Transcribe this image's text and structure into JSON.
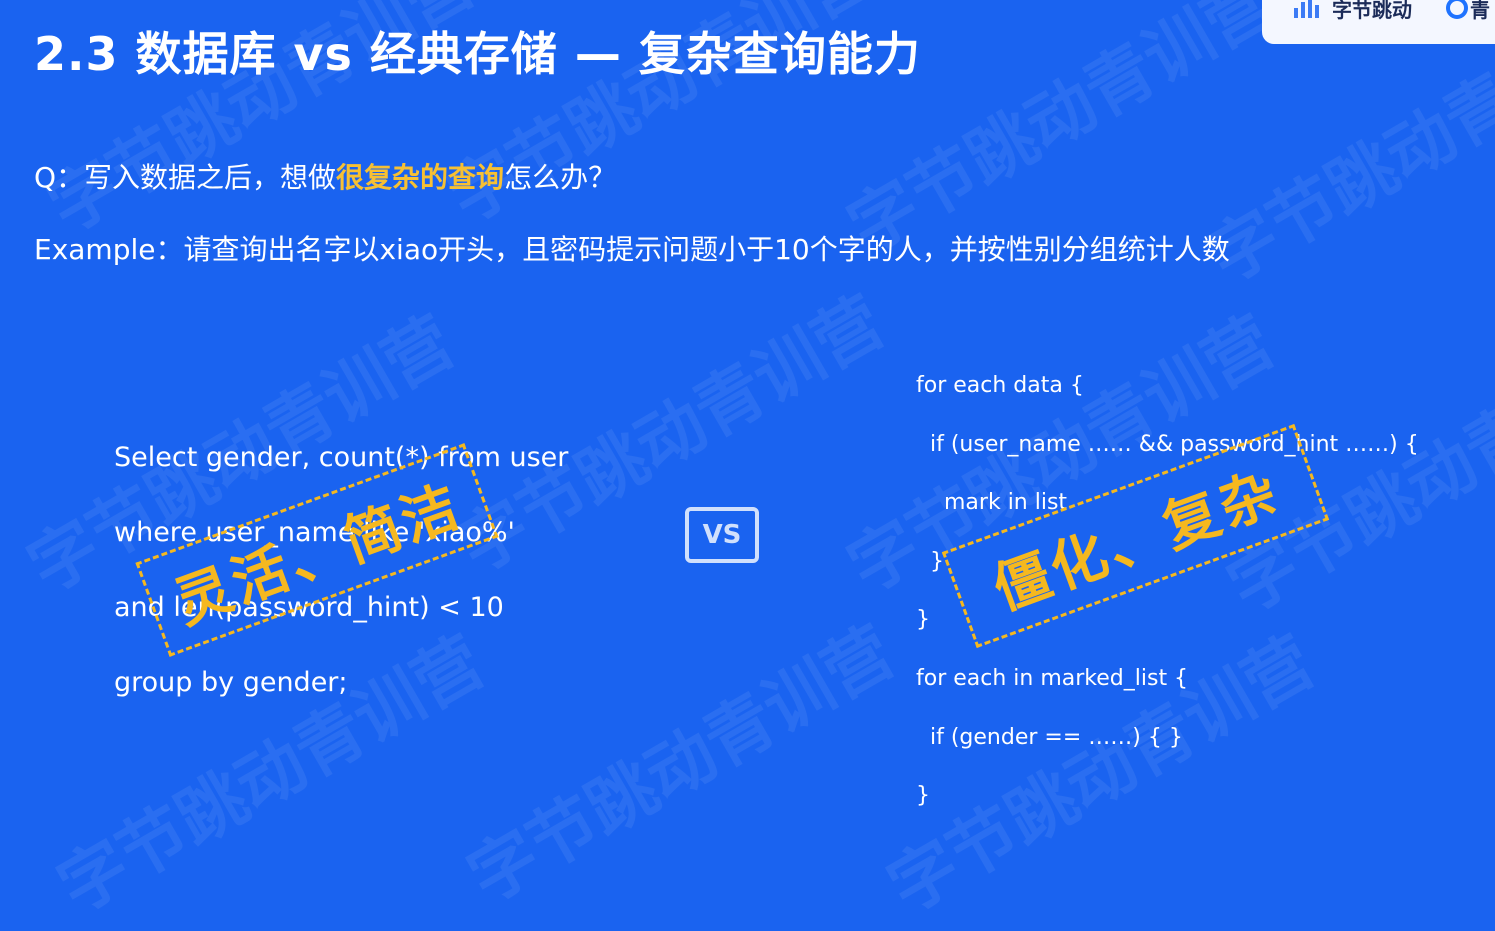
{
  "title": "2.3 数据库 vs 经典存储 — 复杂查询能力",
  "logo": {
    "brand": "字节跳动",
    "brand2": "青"
  },
  "question": {
    "prefix": "Q：写入数据之后，想做",
    "highlight": "很复杂的查询",
    "suffix": "怎么办？"
  },
  "example": "Example：请查询出名字以xiao开头，且密码提示问题小于10个字的人，并按性别分组统计人数",
  "sql_lines": [
    "Select gender, count(*) from user",
    "where user_name like 'xiao%'",
    "and len(password_hint) < 10",
    "group by gender;"
  ],
  "vs_label": "VS",
  "code_lines": [
    "for each data {",
    "  if (user_name …… && password_hint ……) {",
    "    mark in list",
    "  }",
    "}",
    "for each in marked_list {",
    "  if (gender == ……) { }",
    "}"
  ],
  "stamp_left": "灵活、简洁",
  "stamp_right": "僵化、复杂",
  "watermark_text": "字节跳动青训营",
  "colors": {
    "background": "#1a63f0",
    "highlight": "#f7c033",
    "stamp": "#f5b81f"
  }
}
